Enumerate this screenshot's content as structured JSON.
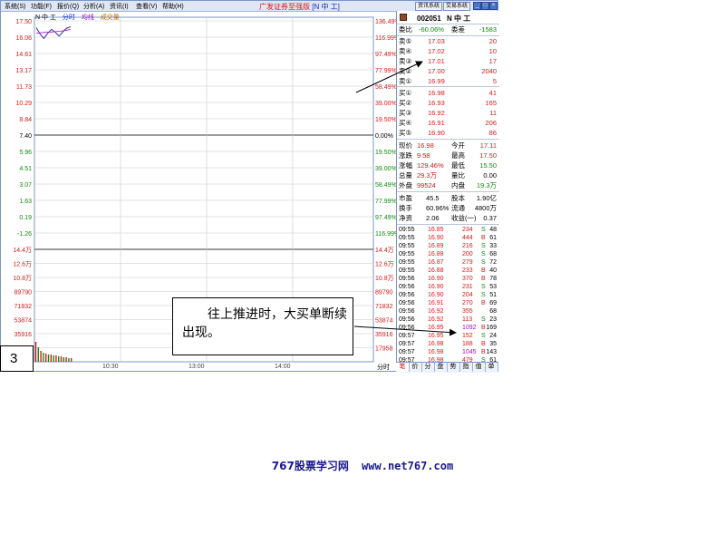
{
  "menubar": {
    "items": [
      "系统(S)",
      "功能(F)",
      "报价(Q)",
      "分析(A)",
      "资讯(I)",
      "查看(V)",
      "帮助(H)"
    ],
    "title_prefix": "广发证券至强版",
    "title_stock": "[N 中  工]",
    "btn_news": "资讯系统",
    "btn_trade": "交易系统",
    "ctrl_min": "_",
    "ctrl_max": "□",
    "ctrl_close": "×"
  },
  "chart": {
    "stock_label": "N 中  工",
    "mode": "分时",
    "legend_avg": "均线",
    "legend_vol": "成交量",
    "price_labels": [
      "17.50",
      "16.06",
      "14.61",
      "13.17",
      "11.73",
      "10.29",
      "8.84",
      "7.40",
      "5.96",
      "4.51",
      "3.07",
      "1.63",
      "0.19",
      "-1.26"
    ],
    "pct_labels": [
      "136.49%",
      "116.99%",
      "97.49%",
      "77.99%",
      "58.49%",
      "39.00%",
      "19.50%",
      "0.00%",
      "19.50%",
      "39.00%",
      "58.49%",
      "77.99%",
      "97.49%",
      "116.99%"
    ],
    "vol_labels": [
      "14.4万",
      "12.6万",
      "10.8万",
      "89790",
      "71832",
      "53874",
      "35916"
    ],
    "vol_right_labels": [
      "14.4万",
      "12.6万",
      "10.8万",
      "89790",
      "71832",
      "53874",
      "35916",
      "17958"
    ],
    "time_labels": [
      "10:30",
      "13:00",
      "14:00"
    ],
    "fenshi_btn": "分时",
    "colors": {
      "price_up": "#d81818",
      "price_down": "#108810",
      "line": "#3a2ab0",
      "avg": "#a010c0",
      "grid": "#c8c8c8"
    }
  },
  "panel": {
    "code": "002051",
    "name": "N 中  工",
    "weibi_label": "委比",
    "weibi_value": "-60.06%",
    "weicha_label": "委差",
    "weicha_value": "-1583",
    "sell": [
      {
        "label": "卖⑤",
        "price": "17.03",
        "vol": "20"
      },
      {
        "label": "卖④",
        "price": "17.02",
        "vol": "10"
      },
      {
        "label": "卖③",
        "price": "17.01",
        "vol": "17"
      },
      {
        "label": "卖②",
        "price": "17.00",
        "vol": "2040"
      },
      {
        "label": "卖①",
        "price": "16.99",
        "vol": "5"
      }
    ],
    "buy": [
      {
        "label": "买①",
        "price": "16.98",
        "vol": "41"
      },
      {
        "label": "买②",
        "price": "16.93",
        "vol": "165"
      },
      {
        "label": "买③",
        "price": "16.92",
        "vol": "11"
      },
      {
        "label": "买④",
        "price": "16.91",
        "vol": "206"
      },
      {
        "label": "买⑤",
        "price": "16.90",
        "vol": "86"
      }
    ],
    "quote": [
      {
        "l1": "现价",
        "v1": "16.98",
        "l2": "今开",
        "v2": "17.11"
      },
      {
        "l1": "涨跌",
        "v1": "9.58",
        "l2": "最高",
        "v2": "17.50"
      },
      {
        "l1": "涨幅",
        "v1": "129.46%",
        "l2": "最低",
        "v2": "15.50"
      },
      {
        "l1": "总量",
        "v1": "29.3万",
        "l2": "量比",
        "v2": "0.00"
      },
      {
        "l1": "外盘",
        "v1": "99524",
        "l2": "内盘",
        "v2": "19.3万"
      }
    ],
    "fund": [
      {
        "l1": "市盈",
        "v1": "45.5",
        "l2": "股本",
        "v2": "1.90亿"
      },
      {
        "l1": "换手",
        "v1": "60.96%",
        "l2": "流通",
        "v2": "4800万"
      },
      {
        "l1": "净资",
        "v1": "2.06",
        "l2": "收益(一)",
        "v2": "0.37"
      }
    ],
    "ticks": [
      {
        "time": "09:55",
        "price": "16.85",
        "vol": "234",
        "bs": "S",
        "n": "48"
      },
      {
        "time": "09:55",
        "price": "16.90",
        "vol": "444",
        "bs": "B",
        "n": "61"
      },
      {
        "time": "09:55",
        "price": "16.89",
        "vol": "216",
        "bs": "S",
        "n": "33"
      },
      {
        "time": "09:55",
        "price": "16.88",
        "vol": "200",
        "bs": "S",
        "n": "68"
      },
      {
        "time": "09:55",
        "price": "16.87",
        "vol": "279",
        "bs": "S",
        "n": "72"
      },
      {
        "time": "09:55",
        "price": "16.88",
        "vol": "233",
        "bs": "B",
        "n": "40"
      },
      {
        "time": "09:56",
        "price": "16.90",
        "vol": "370",
        "bs": "B",
        "n": "78"
      },
      {
        "time": "09:56",
        "price": "16.90",
        "vol": "231",
        "bs": "S",
        "n": "53"
      },
      {
        "time": "09:56",
        "price": "16.90",
        "vol": "204",
        "bs": "S",
        "n": "51"
      },
      {
        "time": "09:56",
        "price": "16.91",
        "vol": "270",
        "bs": "B",
        "n": "69"
      },
      {
        "time": "09:56",
        "price": "16.92",
        "vol": "355",
        "bs": "",
        "n": "68"
      },
      {
        "time": "09:56",
        "price": "16.92",
        "vol": "113",
        "bs": "S",
        "n": "23"
      },
      {
        "time": "09:56",
        "price": "16.95",
        "vol": "1092",
        "bs": "B",
        "n": "169"
      },
      {
        "time": "09:57",
        "price": "16.95",
        "vol": "152",
        "bs": "S",
        "n": "24"
      },
      {
        "time": "09:57",
        "price": "16.98",
        "vol": "188",
        "bs": "B",
        "n": "35"
      },
      {
        "time": "09:57",
        "price": "16.98",
        "vol": "1045",
        "bs": "B",
        "n": "143"
      },
      {
        "time": "09:57",
        "price": "16.98",
        "vol": "479",
        "bs": "S",
        "n": "61"
      }
    ],
    "tabs": [
      "笔",
      "价",
      "分",
      "盘",
      "势",
      "指",
      "值",
      "单"
    ]
  },
  "annotation": {
    "text": "往上推进时，大买单断续出现。",
    "corner_number": "3"
  },
  "footer": {
    "site_name": "767股票学习网",
    "url": "www.net767.com"
  }
}
